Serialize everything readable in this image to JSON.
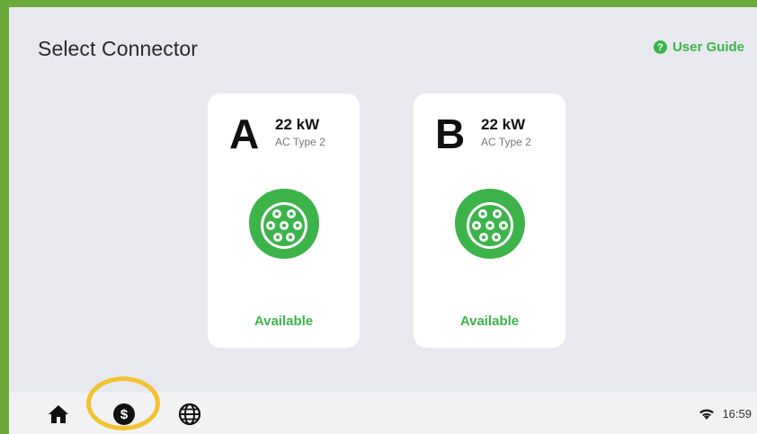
{
  "header": {
    "title": "Select Connector",
    "user_guide": "User Guide",
    "guide_icon": "?"
  },
  "connectors": [
    {
      "letter": "A",
      "power": "22 kW",
      "type": "AC Type 2",
      "status": "Available"
    },
    {
      "letter": "B",
      "power": "22 kW",
      "type": "AC Type 2",
      "status": "Available"
    }
  ],
  "bottombar": {
    "time": "16:59",
    "icons": [
      "home-icon",
      "dollar-icon",
      "globe-icon",
      "wifi-icon"
    ]
  },
  "colors": {
    "accent_green": "#3cb44a",
    "frame_green": "#6aaa3a",
    "highlight_yellow": "#f2c230",
    "background": "#e8e9ee"
  }
}
